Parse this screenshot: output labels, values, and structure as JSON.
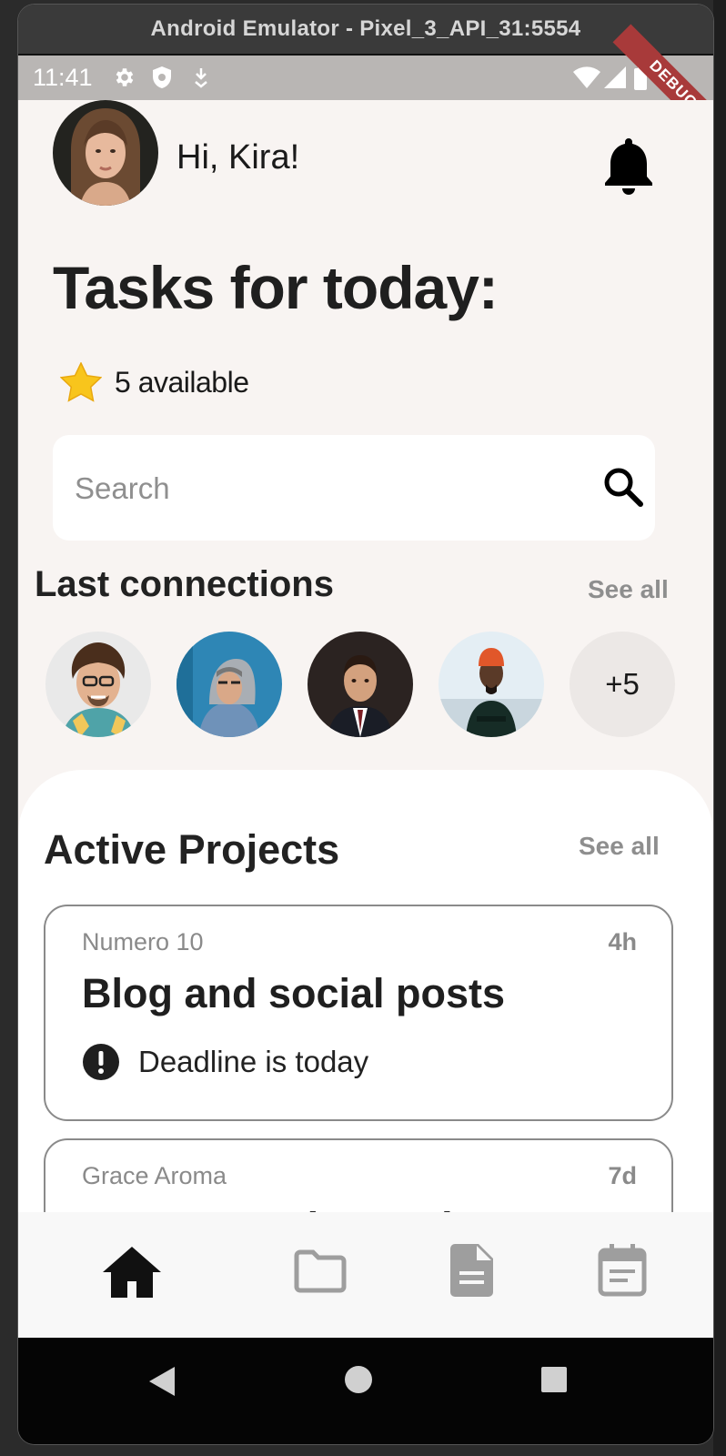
{
  "window": {
    "title": "Android Emulator - Pixel_3_API_31:5554"
  },
  "status_bar": {
    "time": "11:41",
    "debug_banner": "DEBUG"
  },
  "header": {
    "greeting": "Hi, Kira!"
  },
  "tasks": {
    "title": "Tasks for today:",
    "available": "5 available"
  },
  "search": {
    "placeholder": "Search"
  },
  "connections": {
    "title": "Last connections",
    "see_all": "See all",
    "more_count": "+5"
  },
  "projects": {
    "title": "Active Projects",
    "see_all": "See all",
    "items": [
      {
        "client": "Numero 10",
        "time": "4h",
        "title": "Blog and social posts",
        "alert": "Deadline is today"
      },
      {
        "client": "Grace Aroma",
        "time": "7d",
        "title": "New campaign review",
        "alert": ""
      }
    ]
  },
  "bottom_nav": {
    "items": [
      {
        "icon": "home-icon",
        "active": true
      },
      {
        "icon": "folder-icon",
        "active": false
      },
      {
        "icon": "document-icon",
        "active": false
      },
      {
        "icon": "calendar-icon",
        "active": false
      }
    ]
  },
  "colors": {
    "background": "#f8f4f2",
    "card_border": "#8a8a8a",
    "muted_text": "#8e8e8e",
    "nav_active": "#111111",
    "nav_inactive": "#9e9e9e",
    "debug": "#a83a3a"
  }
}
